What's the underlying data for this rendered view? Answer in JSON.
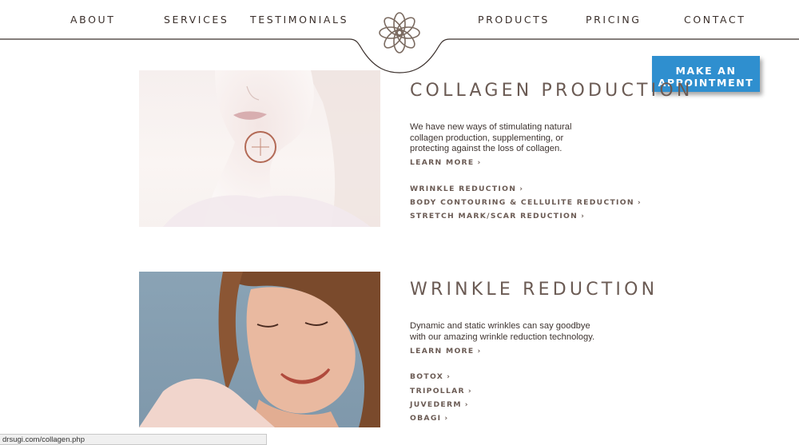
{
  "nav": {
    "items": [
      "ABOUT",
      "SERVICES",
      "TESTIMONIALS",
      "PRODUCTS",
      "PRICING",
      "CONTACT"
    ]
  },
  "cta": {
    "line1": "MAKE AN",
    "line2": "APPOINTMENT"
  },
  "sections": [
    {
      "title": "COLLAGEN PRODUCTION",
      "description": "We have new ways of stimulating natural collagen production, supplementing, or protecting against the loss of collagen.",
      "learn_more": "LEARN MORE",
      "links": [
        "WRINKLE REDUCTION",
        "BODY CONTOURING & CELLULITE REDUCTION",
        "STRETCH MARK/SCAR REDUCTION"
      ]
    },
    {
      "title": "WRINKLE REDUCTION",
      "description": "Dynamic and static wrinkles can say goodbye with our amazing wrinkle reduction technology.",
      "learn_more": "LEARN MORE",
      "links": [
        "BOTOX",
        "TRIPOLLAR",
        "JUVEDERM",
        "OBAGI"
      ]
    }
  ],
  "status_bar": {
    "url": "drsugi.com/collagen.php"
  },
  "colors": {
    "cta": "#2f8fcf",
    "heading": "#6b5b54",
    "nav": "#3a2f2b",
    "logo": "#7a6a60"
  },
  "icons": [
    "flower-logo-icon",
    "chevron-right-icon",
    "plus-icon"
  ]
}
